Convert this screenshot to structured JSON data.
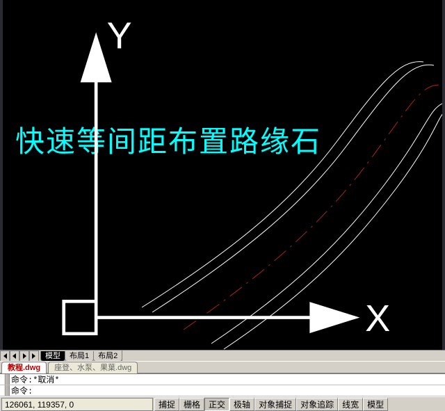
{
  "drawing": {
    "annotation_text": "快速等间距布置路缘石",
    "ucs": {
      "x_label": "X",
      "y_label": "Y"
    }
  },
  "nav_buttons": {
    "first": "⏮",
    "prev": "◀",
    "next": "▶",
    "last": "⏭"
  },
  "layout_tabs": [
    {
      "label": "模型",
      "active": true
    },
    {
      "label": "布局1",
      "active": false
    },
    {
      "label": "布局2",
      "active": false
    }
  ],
  "file_tabs": [
    {
      "label": "教程.dwg",
      "active": true
    },
    {
      "label": "座登、水泵、果葉.dwg",
      "active": false
    }
  ],
  "command": {
    "line1_prefix": "命令:",
    "line1_body": " *取消*",
    "line2_prefix": "命令:",
    "line2_body": ""
  },
  "status": {
    "coords": "126061, 119357, 0",
    "toggles": [
      {
        "label": "捕捉",
        "pressed": false
      },
      {
        "label": "栅格",
        "pressed": false
      },
      {
        "label": "正交",
        "pressed": true
      },
      {
        "label": "极轴",
        "pressed": false
      },
      {
        "label": "对象捕捉",
        "pressed": false
      },
      {
        "label": "对象追踪",
        "pressed": false
      },
      {
        "label": "线宽",
        "pressed": false
      },
      {
        "label": "模型",
        "pressed": false
      }
    ]
  }
}
